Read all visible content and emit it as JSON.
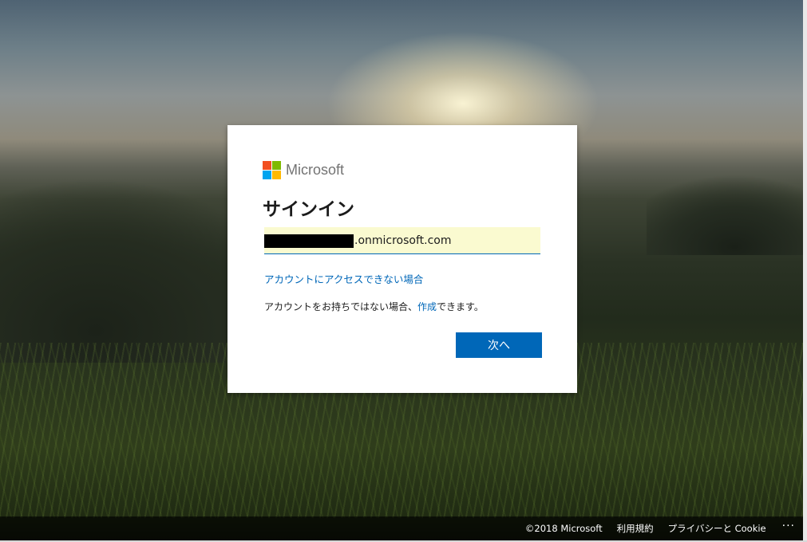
{
  "brand": {
    "name": "Microsoft",
    "colors": {
      "red": "#f25022",
      "green": "#7fba00",
      "blue": "#00a4ef",
      "yellow": "#ffb900"
    }
  },
  "signin": {
    "title": "サインイン",
    "email_suffix": ".onmicrosoft.com",
    "cant_access_link": "アカウントにアクセスできない場合",
    "no_account_prefix": "アカウントをお持ちではない場合、",
    "create_link": "作成",
    "no_account_suffix": "できます。",
    "next_button": "次へ"
  },
  "footer": {
    "copyright": "©2018 Microsoft",
    "terms": "利用規約",
    "privacy": "プライバシーと Cookie",
    "more": "···"
  },
  "colors": {
    "accent": "#0067b8",
    "input_bg": "#fafad0"
  }
}
